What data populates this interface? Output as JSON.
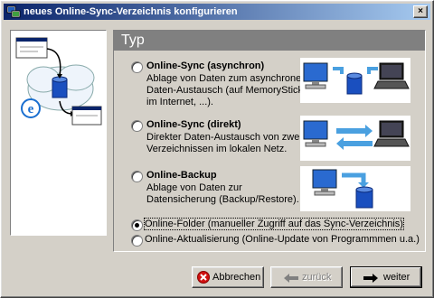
{
  "window": {
    "title": "neues Online-Sync-Verzeichnis konfigurieren",
    "close_glyph": "×"
  },
  "panel": {
    "heading": "Typ"
  },
  "options": [
    {
      "title": "Online-Sync (asynchron)",
      "desc": "Ablage von Daten zum asynchronen Daten-Austausch (auf MemoryStick, im Internet, ...).",
      "selected": false
    },
    {
      "title": "Online-Sync (direkt)",
      "desc": "Direkter Daten-Austausch von zwei Verzeichnissen im lokalen Netz.",
      "selected": false
    },
    {
      "title": "Online-Backup",
      "desc": "Ablage von Daten zur Datensicherung (Backup/Restore).",
      "selected": false
    }
  ],
  "simple_options": [
    {
      "label": "Online-Folder (manueller Zugriff auf das Sync-Verzeichnis)",
      "selected": true
    },
    {
      "label": "Online-Aktualisierung (Online-Update von Programmmen u.a.)",
      "selected": false
    }
  ],
  "buttons": {
    "cancel": "Abbrechen",
    "back": "zurück",
    "next": "weiter"
  },
  "colors": {
    "titlebar_start": "#0a246a",
    "titlebar_end": "#a6caf0",
    "panel_header": "#808080",
    "face": "#d4d0c8"
  }
}
